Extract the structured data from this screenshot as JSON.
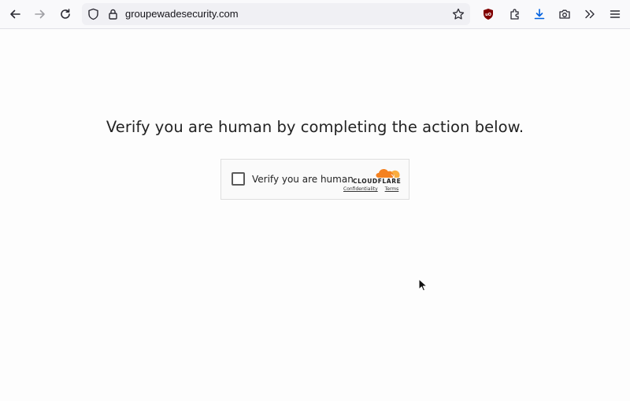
{
  "browser": {
    "url": "groupewadesecurity.com"
  },
  "page": {
    "headline": "Verify you are human by completing the action below."
  },
  "captcha": {
    "checkbox_label": "Verify you are human",
    "checked": false,
    "brand": "CLOUDFLARE",
    "privacy_link": "Confidentiality",
    "terms_link": "Terms"
  },
  "colors": {
    "cloudflare_orange": "#f48120",
    "cloudflare_light_orange": "#faad3f",
    "ublock_red": "#800000",
    "download_blue": "#0060df"
  },
  "icons": [
    "back-icon",
    "forward-icon",
    "reload-icon",
    "shield-icon",
    "lock-icon",
    "star-icon",
    "ublock-icon",
    "extensions-icon",
    "download-icon",
    "screenshot-icon",
    "overflow-icon",
    "menu-icon",
    "mouse-cursor-icon"
  ]
}
